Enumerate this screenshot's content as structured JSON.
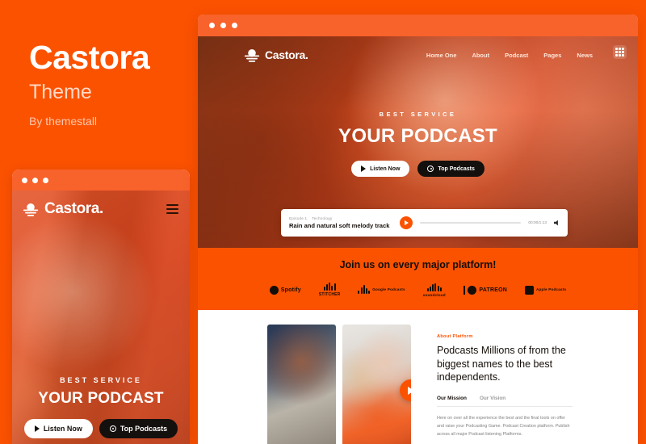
{
  "promo": {
    "title": "Castora",
    "subtitle": "Theme",
    "byline": "By themestall"
  },
  "colors": {
    "brand_orange": "#fb5200",
    "chrome_orange": "#f8622b",
    "dark": "#140d08",
    "white": "#ffffff"
  },
  "site": {
    "logo_text": "Castora.",
    "logo_icon": "sunset-logo-icon",
    "nav": [
      {
        "label": "Home One"
      },
      {
        "label": "About"
      },
      {
        "label": "Podcast"
      },
      {
        "label": "Pages"
      },
      {
        "label": "News"
      }
    ],
    "grid_icon": "grid-menu-icon",
    "hamburger_icon": "hamburger-icon"
  },
  "hero": {
    "eyebrow": "BEST SERVICE",
    "title": "YOUR PODCAST",
    "primary_button": "Listen Now",
    "secondary_button": "Top Podcasts",
    "play_icon": "play-icon",
    "headphone_icon": "headphone-icon"
  },
  "player": {
    "episode": "Episode 1",
    "category": "Technology",
    "track_title": "Rain and natural soft melody track",
    "time": "00:00/1:13",
    "play_icon": "play-circle-icon",
    "volume_icon": "volume-icon"
  },
  "platforms": {
    "heading": "Join us on every major platform!",
    "items": [
      {
        "name": "Spotify",
        "icon": "spotify-icon",
        "style": "inline"
      },
      {
        "name": "STITCHER",
        "icon": "stitcher-icon",
        "style": "stacked"
      },
      {
        "name": "Google Podcasts",
        "icon": "google-podcasts-icon",
        "style": "two-line"
      },
      {
        "name": "soundcloud",
        "icon": "soundcloud-icon",
        "style": "stacked"
      },
      {
        "name": "PATREON",
        "icon": "patreon-icon",
        "style": "inline"
      },
      {
        "name": "Apple Podcasts",
        "icon": "apple-podcasts-icon",
        "style": "two-line"
      }
    ]
  },
  "about": {
    "eyebrow": "About Platform",
    "title": "Podcasts Millions of from the biggest names to the best independents.",
    "tabs": [
      {
        "label": "Our Mission",
        "active": true
      },
      {
        "label": "Our Vision",
        "active": false
      }
    ],
    "body": "Here on over all the experience the best and the final tools on offer and raise your Podcasting Game. Podcast Creation platform. Publish across all major Podcast listening Platforms.",
    "play_icon": "play-circle-icon",
    "image_one_alt": "podcaster-with-microphone-photo",
    "image_two_alt": "two-podcasters-laughing-photo"
  }
}
